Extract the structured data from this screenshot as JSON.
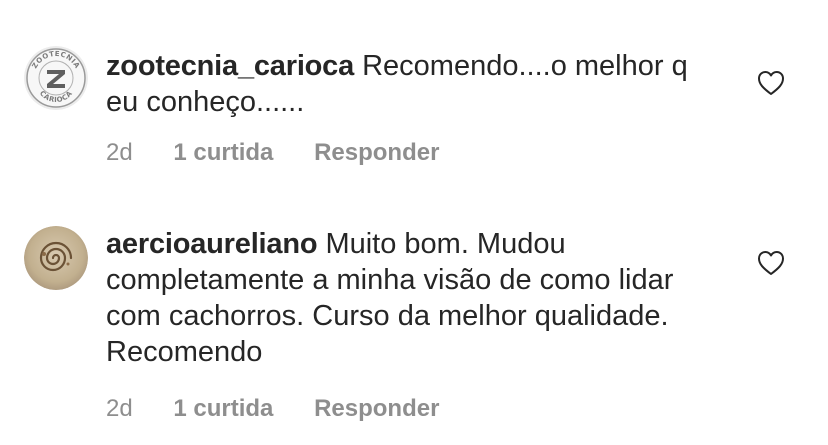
{
  "comments": [
    {
      "username": "zootecnia_carioca",
      "text": "Recomendo....o melhor q eu conheço......",
      "time": "2d",
      "likes": "1 curtida",
      "reply_label": "Responder",
      "like_icon": "heart-outline-icon",
      "avatar_logo_text": "ZOOTECNIA CARIOCA",
      "avatar_letter": "Z"
    },
    {
      "username": "aercioaureliano",
      "text": "Muito bom. Mudou completamente a minha visão de como lidar com cachorros. Curso da melhor qualidade. Recomendo",
      "time": "2d",
      "likes": "1 curtida",
      "reply_label": "Responder",
      "like_icon": "heart-outline-icon"
    }
  ],
  "colors": {
    "text": "#262626",
    "muted": "#8e8e8e",
    "background": "#ffffff"
  }
}
